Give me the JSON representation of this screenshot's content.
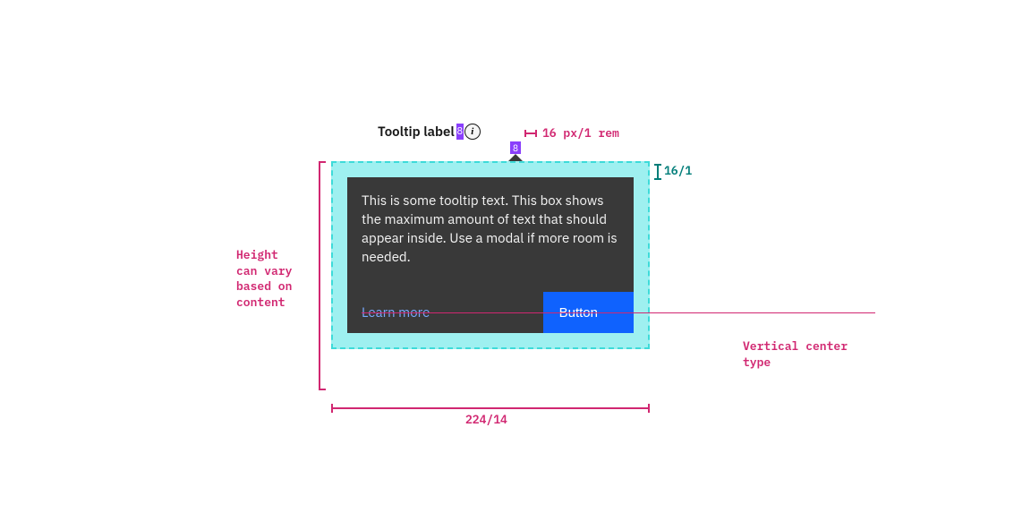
{
  "trigger": {
    "label": "Tooltip label",
    "spacer_top": "8",
    "spacer_bottom": "8",
    "icon_size": "16 px/1 rem"
  },
  "tooltip": {
    "body": "This is some tooltip text. This box shows the maximum amount of text that should appear inside. Use a modal if more room is needed.",
    "link_label": "Learn more",
    "button_label": "Button"
  },
  "annotations": {
    "padding_top": "16/1",
    "height_note": "Height\ncan vary\nbased on\ncontent",
    "width_label": "224/14",
    "vcenter_label": "Vertical center\ntype"
  }
}
